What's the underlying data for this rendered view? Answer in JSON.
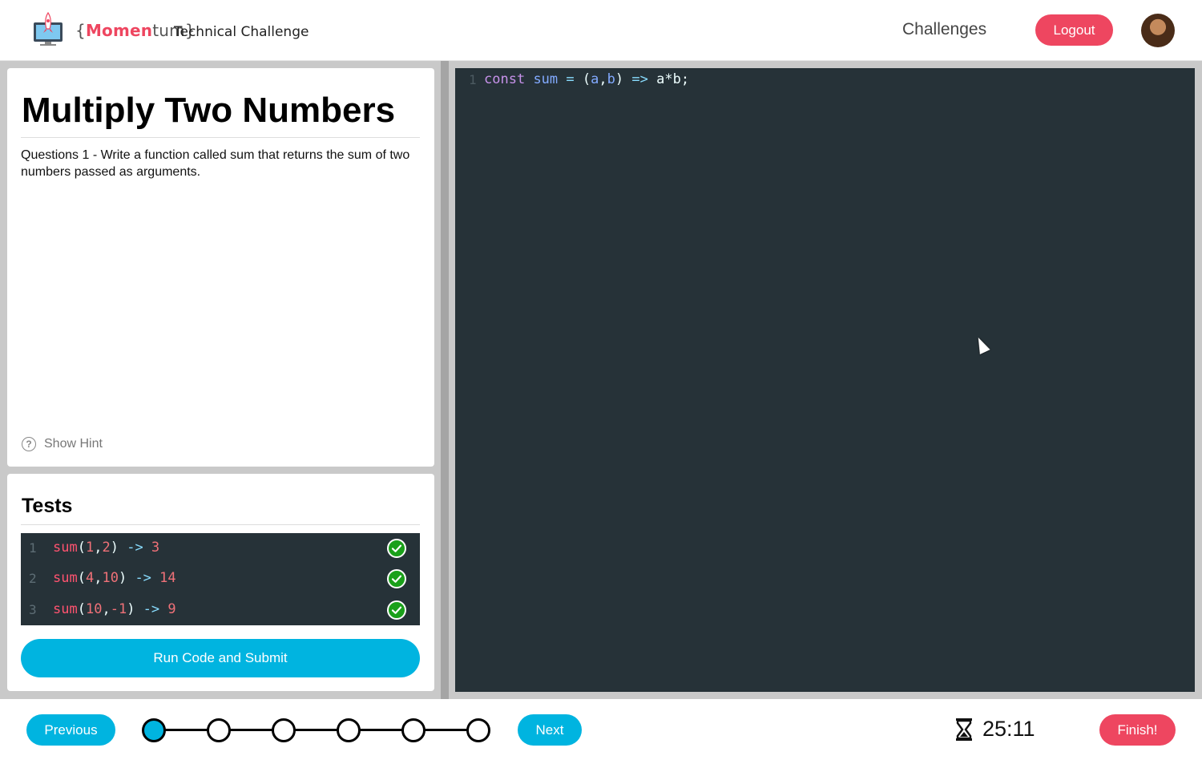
{
  "header": {
    "brand_open": "{",
    "brand_mom": "Momen",
    "brand_tum": "tum",
    "brand_close": "}",
    "tagline": "Technical Challenge",
    "nav_challenges": "Challenges",
    "logout_label": "Logout"
  },
  "question": {
    "title": "Multiply Two Numbers",
    "text": "Questions 1 - Write a function called sum that returns the sum of two numbers passed as arguments.",
    "hint_icon": "?",
    "hint_label": "Show Hint"
  },
  "tests": {
    "title": "Tests",
    "rows": [
      {
        "num": "1",
        "fn": "sum",
        "open": "(",
        "a": "1",
        "sep": ",",
        "b": "2",
        "close": ")",
        "arrow": " -> ",
        "result": "3",
        "status": "passed"
      },
      {
        "num": "2",
        "fn": "sum",
        "open": "(",
        "a": "4",
        "sep": ",",
        "b": "10",
        "close": ")",
        "arrow": " -> ",
        "result": "14",
        "status": "passed"
      },
      {
        "num": "3",
        "fn": "sum",
        "open": "(",
        "a": "10",
        "sep": ",",
        "b": "-1",
        "close": ")",
        "arrow": " -> ",
        "result": "9",
        "status": "passed"
      }
    ],
    "run_label": "Run Code and Submit"
  },
  "editor": {
    "line_number": "1",
    "tokens": {
      "kw": "const",
      "name": "sum",
      "eq": "=",
      "lparen": "(",
      "a": "a",
      "comma": ",",
      "b": "b",
      "rparen": ")",
      "arrow": "=>",
      "body": "a*b;"
    }
  },
  "footer": {
    "previous_label": "Previous",
    "next_label": "Next",
    "steps_total": 6,
    "current_step": 1,
    "timer": "25:11",
    "finish_label": "Finish!"
  },
  "colors": {
    "accent_blue": "#00b4e0",
    "accent_red": "#ee4660",
    "editor_bg": "#263238",
    "pass_green": "#1aa01a"
  },
  "icons": {
    "logo": "rocket-monitor-icon",
    "hint": "question-circle-icon",
    "test_status": "check-circle-icon",
    "timer": "hourglass-icon",
    "cursor": "mouse-pointer-icon"
  }
}
